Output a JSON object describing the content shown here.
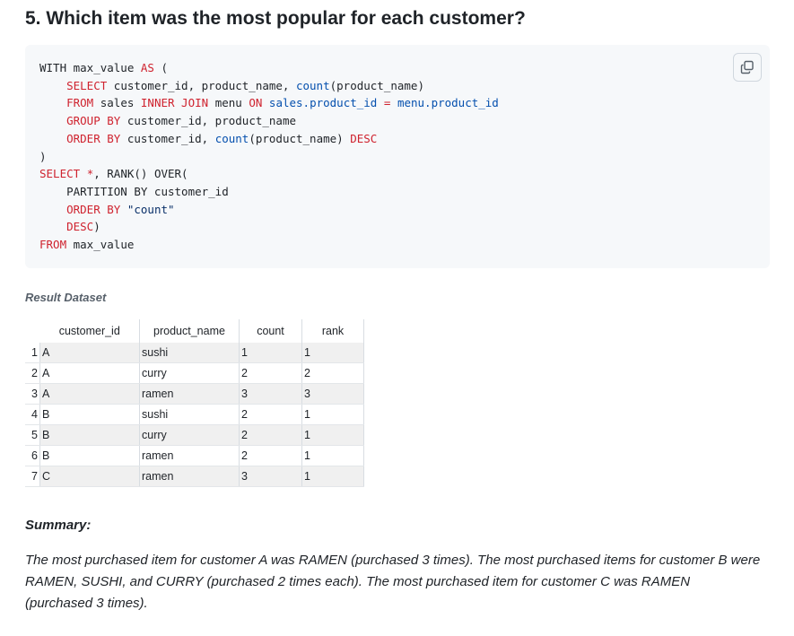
{
  "heading": "5. Which item was the most popular for each customer?",
  "code_lines": [
    [
      {
        "t": "WITH max_value "
      },
      {
        "t": "AS",
        "c": "kw"
      },
      {
        "t": " ("
      }
    ],
    [
      {
        "t": "    "
      },
      {
        "t": "SELECT",
        "c": "kw"
      },
      {
        "t": " customer_id, product_name, "
      },
      {
        "t": "count",
        "c": "fn"
      },
      {
        "t": "(product_name)"
      }
    ],
    [
      {
        "t": "    "
      },
      {
        "t": "FROM",
        "c": "kw"
      },
      {
        "t": " sales "
      },
      {
        "t": "INNER JOIN",
        "c": "kw"
      },
      {
        "t": " menu "
      },
      {
        "t": "ON",
        "c": "kw"
      },
      {
        "t": " "
      },
      {
        "t": "sales.product_id",
        "c": "fn"
      },
      {
        "t": " "
      },
      {
        "t": "=",
        "c": "kw"
      },
      {
        "t": " "
      },
      {
        "t": "menu.product_id",
        "c": "fn"
      }
    ],
    [
      {
        "t": "    "
      },
      {
        "t": "GROUP BY",
        "c": "kw"
      },
      {
        "t": " customer_id, product_name"
      }
    ],
    [
      {
        "t": "    "
      },
      {
        "t": "ORDER BY",
        "c": "kw"
      },
      {
        "t": " customer_id, "
      },
      {
        "t": "count",
        "c": "fn"
      },
      {
        "t": "(product_name) "
      },
      {
        "t": "DESC",
        "c": "kw"
      }
    ],
    [
      {
        "t": ")"
      }
    ],
    [
      {
        "t": "SELECT",
        "c": "kw"
      },
      {
        "t": " "
      },
      {
        "t": "*",
        "c": "kw"
      },
      {
        "t": ", RANK() OVER("
      }
    ],
    [
      {
        "t": "    PARTITION BY customer_id"
      }
    ],
    [
      {
        "t": "    "
      },
      {
        "t": "ORDER BY",
        "c": "kw"
      },
      {
        "t": " "
      },
      {
        "t": "\"count\"",
        "c": "str"
      }
    ],
    [
      {
        "t": "    "
      },
      {
        "t": "DESC",
        "c": "kw"
      },
      {
        "t": ")"
      }
    ],
    [
      {
        "t": "FROM",
        "c": "kw"
      },
      {
        "t": " max_value"
      }
    ]
  ],
  "copy_icon": "copy-icon",
  "result_label": "Result Dataset",
  "table": {
    "columns": [
      "customer_id",
      "product_name",
      "count",
      "rank"
    ],
    "rows": [
      {
        "idx": "1",
        "cells": [
          "A",
          "sushi",
          "1",
          "1"
        ]
      },
      {
        "idx": "2",
        "cells": [
          "A",
          "curry",
          "2",
          "2"
        ]
      },
      {
        "idx": "3",
        "cells": [
          "A",
          "ramen",
          "3",
          "3"
        ]
      },
      {
        "idx": "4",
        "cells": [
          "B",
          "sushi",
          "2",
          "1"
        ]
      },
      {
        "idx": "5",
        "cells": [
          "B",
          "curry",
          "2",
          "1"
        ]
      },
      {
        "idx": "6",
        "cells": [
          "B",
          "ramen",
          "2",
          "1"
        ]
      },
      {
        "idx": "7",
        "cells": [
          "C",
          "ramen",
          "3",
          "1"
        ]
      }
    ]
  },
  "summary_title": "Summary:",
  "summary_text": "The most purchased item for customer A was RAMEN (purchased 3 times). The most purchased items for customer B were RAMEN, SUSHI, and CURRY (purchased 2 times each). The most purchased item for customer C was RAMEN (purchased 3 times)."
}
